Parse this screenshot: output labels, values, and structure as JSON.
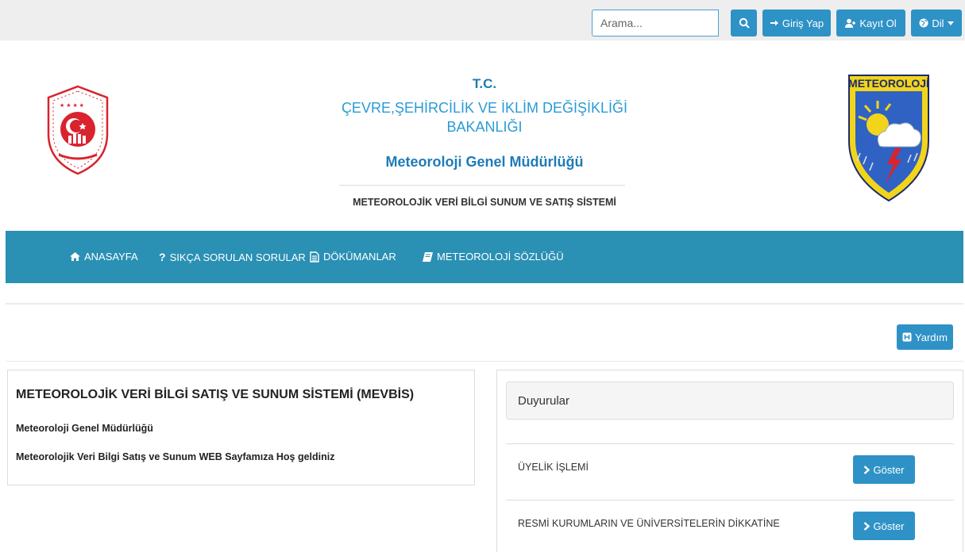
{
  "topbar": {
    "search_placeholder": "Arama...",
    "login_label": "Giriş Yap",
    "register_label": "Kayıt Ol",
    "language_label": "Dil"
  },
  "header": {
    "tc": "T.C.",
    "ministry_line1": "ÇEVRE,ŞEHİRCİLİK VE İKLİM DEĞİŞİKLİĞİ",
    "ministry_line2": "BAKANLIĞI",
    "directorate": "Meteoroloji Genel Müdürlüğü",
    "system_name": "METEOROLOJİK VERİ BİLGİ SUNUM VE SATIŞ SİSTEMİ",
    "right_logo_text": "METEOROLOJİ"
  },
  "nav": {
    "items": [
      {
        "label": "ANASAYFA",
        "icon": "home-icon"
      },
      {
        "label": "SIKÇA SORULAN SORULAR",
        "icon": "question-icon"
      },
      {
        "label": "DÖKÜMANLAR",
        "icon": "document-icon"
      },
      {
        "label": "METEOROLOJİ SÖZLÜĞÜ",
        "icon": "book-icon"
      }
    ]
  },
  "help_label": "Yardım",
  "welcome": {
    "title": "METEOROLOJİK VERİ BİLGİ SATIŞ VE SUNUM SİSTEMİ  (MEVBİS)",
    "line1": "Meteoroloji Genel Müdürlüğü",
    "line2": "Meteorolojik Veri Bilgi Satış ve Sunum WEB Sayfamıza Hoş geldiniz"
  },
  "announcements": {
    "heading": "Duyurular",
    "show_label": "Göster",
    "items": [
      {
        "title": "ÜYELİK İŞLEMİ"
      },
      {
        "title": "RESMİ KURUMLARIN VE ÜNİVERSİTELERİN DİKKATİNE"
      }
    ]
  },
  "colors": {
    "primary": "#2e92c7",
    "navbar": "#2a90b4",
    "heading_blue": "#1f7bb6",
    "emblem_red": "#d9232d",
    "logo_yellow": "#f2d51b"
  }
}
